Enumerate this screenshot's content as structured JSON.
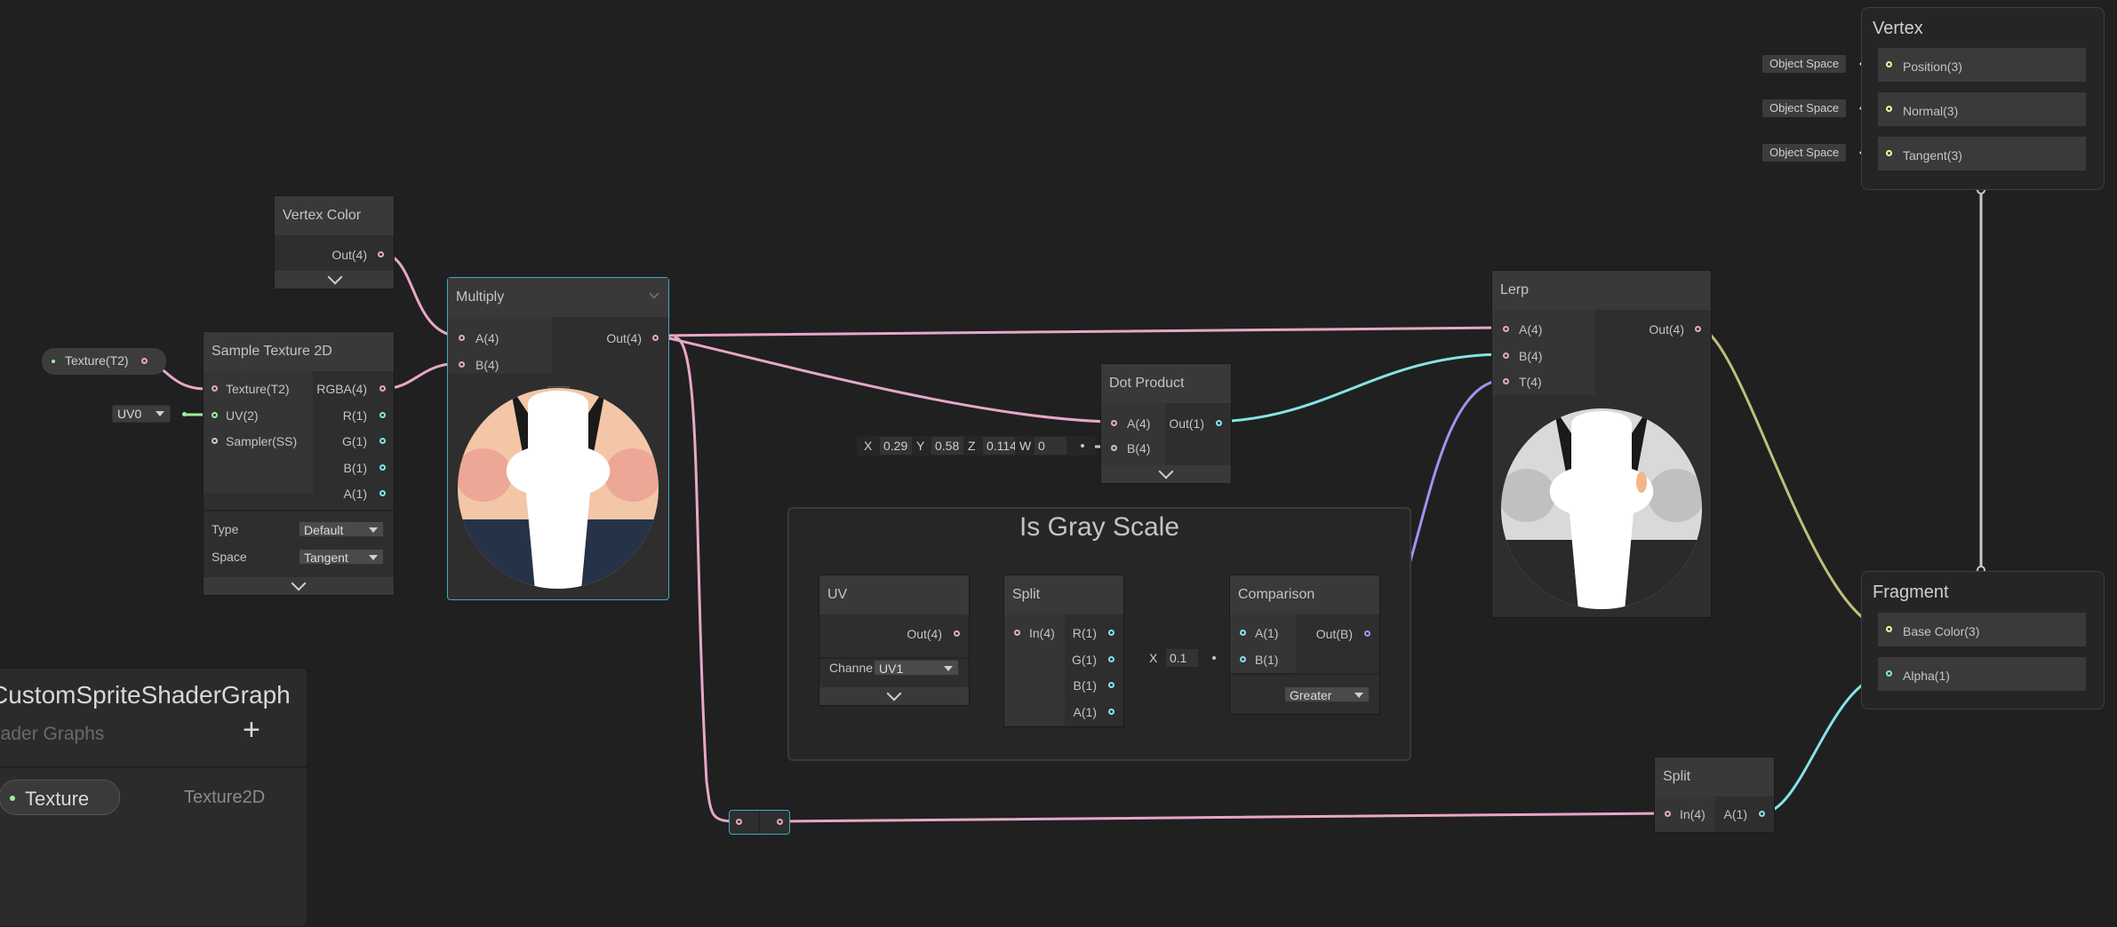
{
  "blackboard": {
    "title": "CustomSpriteShaderGraph",
    "subtitle": "hader Graphs",
    "add_label": "+",
    "property_name": "Texture",
    "property_type": "Texture2D"
  },
  "nodes": {
    "vertex_color": {
      "title": "Vertex Color",
      "out": "Out(4)"
    },
    "texture_prop": {
      "label": "Texture(T2)"
    },
    "uv0_dropdown": {
      "value": "UV0"
    },
    "sample_texture": {
      "title": "Sample Texture 2D",
      "inputs": [
        "Texture(T2)",
        "UV(2)",
        "Sampler(SS)"
      ],
      "outputs": [
        "RGBA(4)",
        "R(1)",
        "G(1)",
        "B(1)",
        "A(1)"
      ],
      "type_label": "Type",
      "type_value": "Default",
      "space_label": "Space",
      "space_value": "Tangent"
    },
    "multiply": {
      "title": "Multiply",
      "inputs": [
        "A(4)",
        "B(4)"
      ],
      "out": "Out(4)"
    },
    "dot_product": {
      "title": "Dot Product",
      "inputs": [
        "A(4)",
        "B(4)"
      ],
      "out": "Out(1)",
      "vector_fields": [
        {
          "label": "X",
          "value": "0.29"
        },
        {
          "label": "Y",
          "value": "0.58"
        },
        {
          "label": "Z",
          "value": "0.114"
        },
        {
          "label": "W",
          "value": "0"
        }
      ]
    },
    "group": {
      "title": "Is Gray Scale"
    },
    "uv": {
      "title": "UV",
      "out": "Out(4)",
      "channel_label": "Channe",
      "channel_value": "UV1"
    },
    "split_inner": {
      "title": "Split",
      "input": "In(4)",
      "outputs": [
        "R(1)",
        "G(1)",
        "B(1)",
        "A(1)"
      ]
    },
    "comparison": {
      "title": "Comparison",
      "inputs": [
        "A(1)",
        "B(1)"
      ],
      "out": "Out(B)",
      "b_field_label": "X",
      "b_field_value": "0.1",
      "op": "Greater"
    },
    "lerp": {
      "title": "Lerp",
      "inputs": [
        "A(4)",
        "B(4)",
        "T(4)"
      ],
      "out": "Out(4)"
    },
    "split_outer": {
      "title": "Split",
      "input": "In(4)",
      "out": "A(1)"
    },
    "vertex_stack": {
      "title": "Vertex",
      "blocks": [
        {
          "space": "Object Space",
          "label": "Position(3)"
        },
        {
          "space": "Object Space",
          "label": "Normal(3)"
        },
        {
          "space": "Object Space",
          "label": "Tangent(3)"
        }
      ]
    },
    "fragment_stack": {
      "title": "Fragment",
      "blocks": [
        "Base Color(3)",
        "Alpha(1)"
      ]
    }
  },
  "colors": {
    "background": "#202020",
    "wire_vec4": "#e7a7c9",
    "wire_float": "#84e4e7",
    "wire_bool": "#a392f0",
    "wire_vec3": "#f4f49b",
    "wire_vec2": "#9bf09b",
    "wire_gray": "#c8c8c8"
  }
}
